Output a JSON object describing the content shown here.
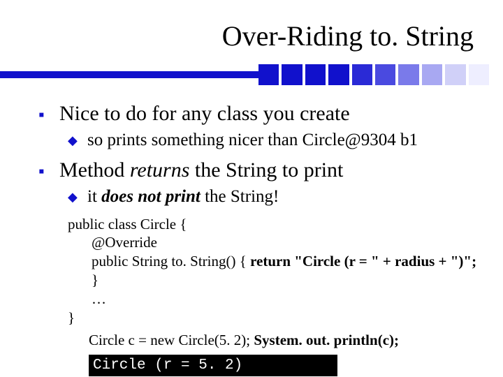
{
  "title": "Over-Riding to. String",
  "decor_colors": [
    "#1111cc",
    "#1111cc",
    "#1111cc",
    "#1111cc",
    "#2a2ad6",
    "#4a4ae0",
    "#7a7aea",
    "#a8a8f2",
    "#d0d0f8",
    "#eeeeff"
  ],
  "b1": {
    "text": "Nice to do for any class you create",
    "sub": "so prints something nicer than Circle@9304 b1"
  },
  "b2": {
    "pre": "Method ",
    "em": "returns",
    "post": " the String to print",
    "sub_pre": "it ",
    "sub_em": "does not print",
    "sub_post": " the String!"
  },
  "code": {
    "l1": "public class Circle {",
    "l2": "@Override",
    "l3_a": "public String to. String() { ",
    "l3_b": "return \"Circle (r = \" + radius + \")\";",
    "l3_c": " }",
    "l4": "…",
    "l5": "}"
  },
  "call_a": "Circle c = new Circle(5. 2);  ",
  "call_b": "System. out. println(c);",
  "output": "Circle (r = 5. 2)"
}
